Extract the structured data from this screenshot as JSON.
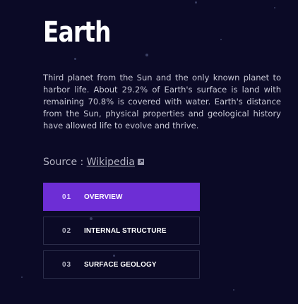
{
  "planet": {
    "name": "Earth",
    "description": "Third planet from the Sun and the only known planet to harbor life. About 29.2% of Earth's surface is land with remaining 70.8% is covered with water. Earth's distance from the Sun, physical properties and geological history have allowed life to evolve and thrive.",
    "source_label": "Source :",
    "source_link": "Wikipedia"
  },
  "tabs": [
    {
      "number": "01",
      "label": "OVERVIEW",
      "active": true
    },
    {
      "number": "02",
      "label": "INTERNAL STRUCTURE",
      "active": false
    },
    {
      "number": "03",
      "label": "SURFACE GEOLOGY",
      "active": false
    }
  ],
  "colors": {
    "background": "#0b0a26",
    "accent": "#6d2ed5",
    "tab_border": "#2b2d4a"
  },
  "icons": {
    "external_link": "external-link-icon"
  }
}
